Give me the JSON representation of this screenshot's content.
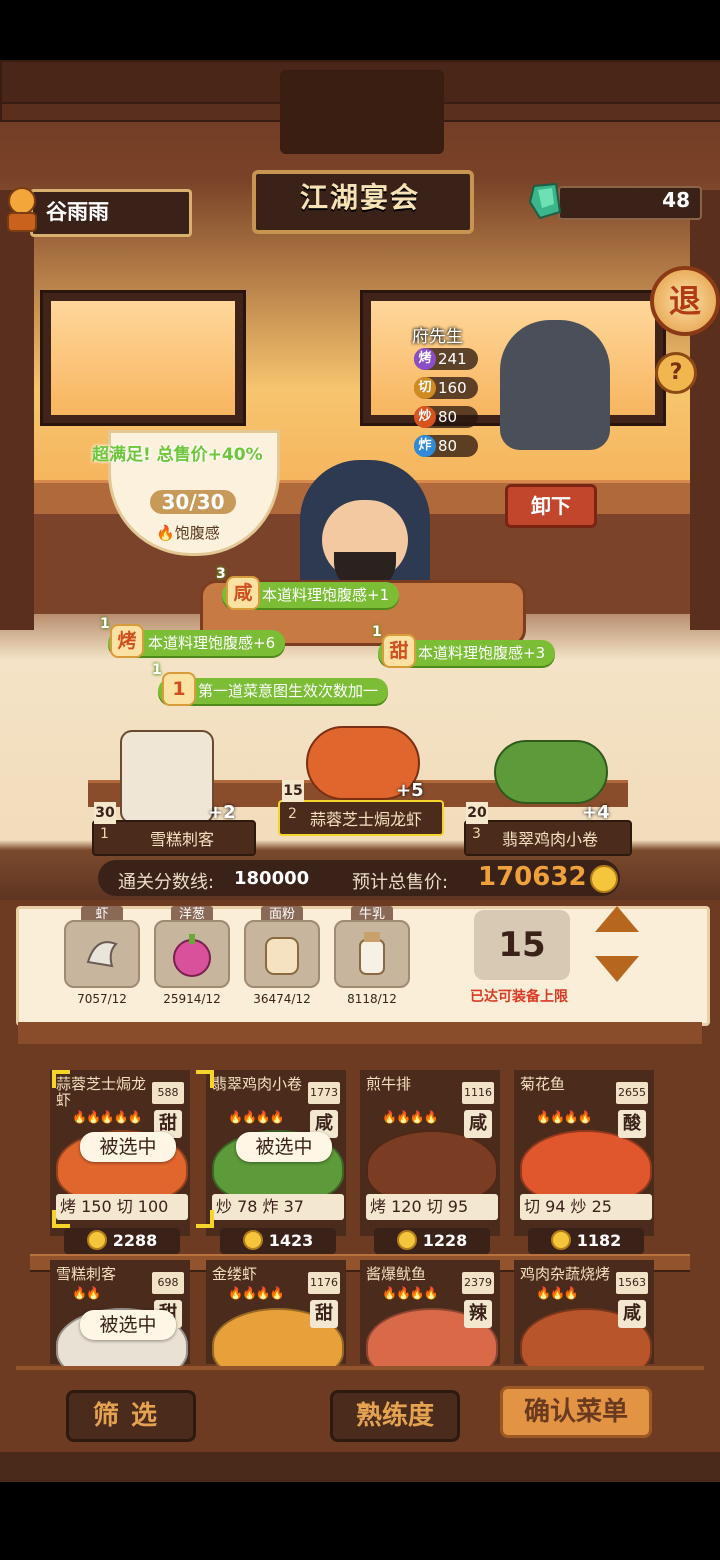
{
  "hud": {
    "player_name": "谷雨雨",
    "gem_count": "48",
    "title": "江湖宴会",
    "exit_label": "退",
    "help_label": "?"
  },
  "chef": {
    "name": "府先生",
    "stats": [
      {
        "badge": "烤",
        "value": "241",
        "color": "#8a4fc7"
      },
      {
        "badge": "切",
        "value": "160",
        "color": "#d18a1f"
      },
      {
        "badge": "炒",
        "value": "80",
        "color": "#d8541f"
      },
      {
        "badge": "炸",
        "value": "80",
        "color": "#2f8bd8"
      }
    ],
    "unload_label": "卸下"
  },
  "satiety": {
    "bonus_text": "超满足!  总售价+40%",
    "count": "30/30",
    "label": "饱腹感"
  },
  "effects": [
    {
      "level": "3",
      "icon": "咸",
      "text": "本道料理饱腹感+1"
    },
    {
      "level": "1",
      "icon": "烤",
      "text": "本道料理饱腹感+6"
    },
    {
      "level": "1",
      "icon": "甜",
      "text": "本道料理饱腹感+3"
    },
    {
      "level": "1",
      "icon": "1",
      "text": "第一道菜意图生效次数加一"
    }
  ],
  "slots": [
    {
      "index": "1",
      "name": "雪糕刺客",
      "count": "30",
      "bonus": "+2"
    },
    {
      "index": "2",
      "name": "蒜蓉芝士焗龙虾",
      "count": "15",
      "bonus": "+5"
    },
    {
      "index": "3",
      "name": "翡翠鸡肉小卷",
      "count": "20",
      "bonus": "+4"
    }
  ],
  "score": {
    "threshold_label": "通关分数线:",
    "threshold_value": "180000",
    "price_label": "预计总售价:",
    "price_value": "170632"
  },
  "ingredients": [
    {
      "name": "虾",
      "count": "7057/12",
      "icon": "shrimp-icon"
    },
    {
      "name": "洋葱",
      "count": "25914/12",
      "icon": "onion-icon"
    },
    {
      "name": "面粉",
      "count": "36474/12",
      "icon": "flour-icon"
    },
    {
      "name": "牛乳",
      "count": "8118/12",
      "icon": "milk-icon"
    }
  ],
  "quantity": {
    "value": "15",
    "note": "已达可装备上限"
  },
  "dishes": [
    {
      "name": "蒜蓉芝士焗龙虾",
      "satiety": "588",
      "flavor": "甜",
      "stars": "🔥🔥🔥🔥🔥",
      "selected": "被选中",
      "stats": "烤 150  切 100",
      "price": "2288",
      "color": "#e0662d"
    },
    {
      "name": "翡翠鸡肉小卷",
      "satiety": "1773",
      "flavor": "咸",
      "stars": "🔥🔥🔥🔥",
      "selected": "被选中",
      "stats": "炒 78  炸 37",
      "price": "1423",
      "color": "#5c9a3a"
    },
    {
      "name": "煎牛排",
      "satiety": "1116",
      "flavor": "咸",
      "stars": "🔥🔥🔥🔥",
      "selected": "",
      "stats": "烤 120  切 95",
      "price": "1228",
      "color": "#7a3d23"
    },
    {
      "name": "菊花鱼",
      "satiety": "2655",
      "flavor": "酸",
      "stars": "🔥🔥🔥🔥",
      "selected": "",
      "stats": "切 94  炒 25",
      "price": "1182",
      "color": "#e0572d"
    },
    {
      "name": "雪糕刺客",
      "satiety": "698",
      "flavor": "甜",
      "stars": "🔥🔥",
      "selected": "被选中",
      "color": "#e9e1d3"
    },
    {
      "name": "金缕虾",
      "satiety": "1176",
      "flavor": "甜",
      "stars": "🔥🔥🔥🔥",
      "selected": "",
      "color": "#e7a03a"
    },
    {
      "name": "酱爆鱿鱼",
      "satiety": "2379",
      "flavor": "辣",
      "stars": "🔥🔥🔥🔥",
      "selected": "",
      "color": "#d86a4a"
    },
    {
      "name": "鸡肉杂蔬烧烤",
      "satiety": "1563",
      "flavor": "咸",
      "stars": "🔥🔥🔥",
      "selected": "",
      "color": "#b8552a"
    }
  ],
  "buttons": {
    "filter": "筛选",
    "proficiency": "熟练度",
    "confirm": "确认菜单"
  }
}
